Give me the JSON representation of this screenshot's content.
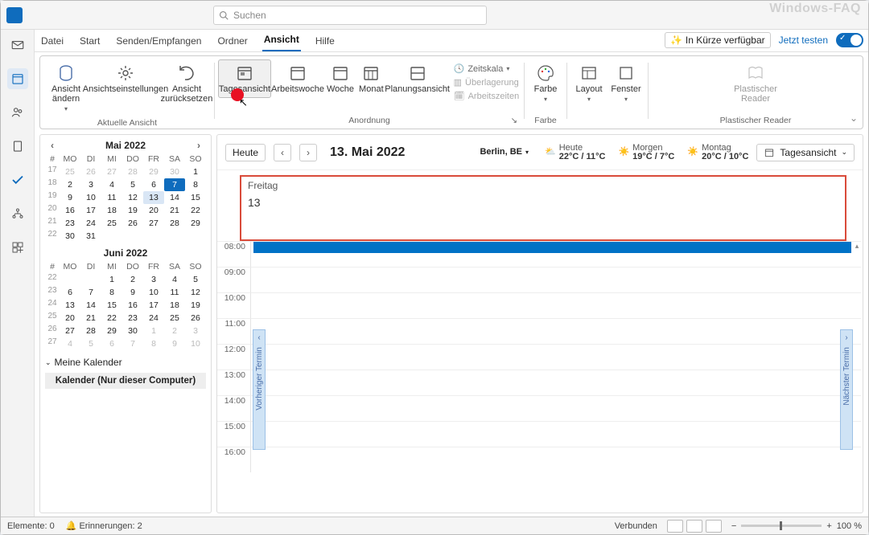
{
  "watermark": "Windows-FAQ",
  "titlebar": {
    "search_placeholder": "Suchen"
  },
  "titleright": {
    "soon_label": "In Kürze verfügbar",
    "try_label": "Jetzt testen"
  },
  "tabs": {
    "file": "Datei",
    "start": "Start",
    "sendrecv": "Senden/Empfangen",
    "folder": "Ordner",
    "view": "Ansicht",
    "help": "Hilfe"
  },
  "ribbon": {
    "group_currentview": "Aktuelle Ansicht",
    "change_view": "Ansicht\nändern",
    "view_settings": "Ansichtseinstellungen",
    "reset_view": "Ansicht\nzurücksetzen",
    "group_arrangement": "Anordnung",
    "day_view": "Tagesansicht",
    "work_week": "Arbeitswoche",
    "week": "Woche",
    "month": "Monat",
    "planning": "Planungsansicht",
    "time_scale": "Zeitskala",
    "overlay": "Überlagerung",
    "working_hours": "Arbeitszeiten",
    "group_color": "Farbe",
    "color": "Farbe",
    "layout": "Layout",
    "window": "Fenster",
    "group_reader": "Plastischer Reader",
    "reader": "Plastischer\nReader"
  },
  "minicals": {
    "dayhdr_wk": "#",
    "dayhdr": [
      "MO",
      "DI",
      "MI",
      "DO",
      "FR",
      "SA",
      "SO"
    ],
    "months": [
      {
        "title": "Mai 2022",
        "nav": true,
        "weeks": [
          {
            "wk": "17",
            "days": [
              {
                "n": "25",
                "o": true
              },
              {
                "n": "26",
                "o": true
              },
              {
                "n": "27",
                "o": true
              },
              {
                "n": "28",
                "o": true
              },
              {
                "n": "29",
                "o": true
              },
              {
                "n": "30",
                "o": true
              },
              {
                "n": "1"
              }
            ]
          },
          {
            "wk": "18",
            "days": [
              {
                "n": "2"
              },
              {
                "n": "3"
              },
              {
                "n": "4"
              },
              {
                "n": "5"
              },
              {
                "n": "6"
              },
              {
                "n": "7",
                "today": true
              },
              {
                "n": "8"
              }
            ]
          },
          {
            "wk": "19",
            "days": [
              {
                "n": "9"
              },
              {
                "n": "10"
              },
              {
                "n": "11"
              },
              {
                "n": "12"
              },
              {
                "n": "13",
                "sel": true
              },
              {
                "n": "14"
              },
              {
                "n": "15"
              }
            ]
          },
          {
            "wk": "20",
            "days": [
              {
                "n": "16"
              },
              {
                "n": "17"
              },
              {
                "n": "18"
              },
              {
                "n": "19"
              },
              {
                "n": "20"
              },
              {
                "n": "21"
              },
              {
                "n": "22"
              }
            ]
          },
          {
            "wk": "21",
            "days": [
              {
                "n": "23"
              },
              {
                "n": "24"
              },
              {
                "n": "25"
              },
              {
                "n": "26"
              },
              {
                "n": "27"
              },
              {
                "n": "28"
              },
              {
                "n": "29"
              }
            ]
          },
          {
            "wk": "22",
            "days": [
              {
                "n": "30"
              },
              {
                "n": "31"
              },
              {
                "n": "",
                "o": true
              },
              {
                "n": "",
                "o": true
              },
              {
                "n": "",
                "o": true
              },
              {
                "n": "",
                "o": true
              },
              {
                "n": "",
                "o": true
              }
            ]
          }
        ]
      },
      {
        "title": "Juni 2022",
        "nav": false,
        "weeks": [
          {
            "wk": "22",
            "days": [
              {
                "n": "",
                "o": true
              },
              {
                "n": "",
                "o": true
              },
              {
                "n": "1"
              },
              {
                "n": "2"
              },
              {
                "n": "3"
              },
              {
                "n": "4"
              },
              {
                "n": "5"
              }
            ]
          },
          {
            "wk": "23",
            "days": [
              {
                "n": "6"
              },
              {
                "n": "7"
              },
              {
                "n": "8"
              },
              {
                "n": "9"
              },
              {
                "n": "10"
              },
              {
                "n": "11"
              },
              {
                "n": "12"
              }
            ]
          },
          {
            "wk": "24",
            "days": [
              {
                "n": "13"
              },
              {
                "n": "14"
              },
              {
                "n": "15"
              },
              {
                "n": "16"
              },
              {
                "n": "17"
              },
              {
                "n": "18"
              },
              {
                "n": "19"
              }
            ]
          },
          {
            "wk": "25",
            "days": [
              {
                "n": "20"
              },
              {
                "n": "21"
              },
              {
                "n": "22"
              },
              {
                "n": "23"
              },
              {
                "n": "24"
              },
              {
                "n": "25"
              },
              {
                "n": "26"
              }
            ]
          },
          {
            "wk": "26",
            "days": [
              {
                "n": "27"
              },
              {
                "n": "28"
              },
              {
                "n": "29"
              },
              {
                "n": "30"
              },
              {
                "n": "1",
                "o": true
              },
              {
                "n": "2",
                "o": true
              },
              {
                "n": "3",
                "o": true
              }
            ]
          },
          {
            "wk": "27",
            "days": [
              {
                "n": "4",
                "o": true
              },
              {
                "n": "5",
                "o": true
              },
              {
                "n": "6",
                "o": true
              },
              {
                "n": "7",
                "o": true
              },
              {
                "n": "8",
                "o": true
              },
              {
                "n": "9",
                "o": true
              },
              {
                "n": "10",
                "o": true
              }
            ]
          }
        ]
      }
    ],
    "group_header": "Meine Kalender",
    "calendar_item": "Kalender (Nur dieser Computer)"
  },
  "calview": {
    "today_btn": "Heute",
    "date_title": "13. Mai 2022",
    "location": "Berlin, BE",
    "weather": [
      {
        "label": "Heute",
        "temp": "22°C / 11°C",
        "icon": "cloud-sun"
      },
      {
        "label": "Morgen",
        "temp": "19°C / 7°C",
        "icon": "sun"
      },
      {
        "label": "Montag",
        "temp": "20°C / 10°C",
        "icon": "sun"
      }
    ],
    "view_selector": "Tagesansicht",
    "day_name": "Freitag",
    "day_num": "13",
    "hours": [
      "08:00",
      "09:00",
      "10:00",
      "11:00",
      "12:00",
      "13:00",
      "14:00",
      "15:00",
      "16:00"
    ],
    "prev_appt": "Vorheriger Termin",
    "next_appt": "Nächster Termin"
  },
  "statusbar": {
    "items": "Elemente: 0",
    "reminders": "Erinnerungen: 2",
    "connected": "Verbunden",
    "zoom": "100 %"
  }
}
